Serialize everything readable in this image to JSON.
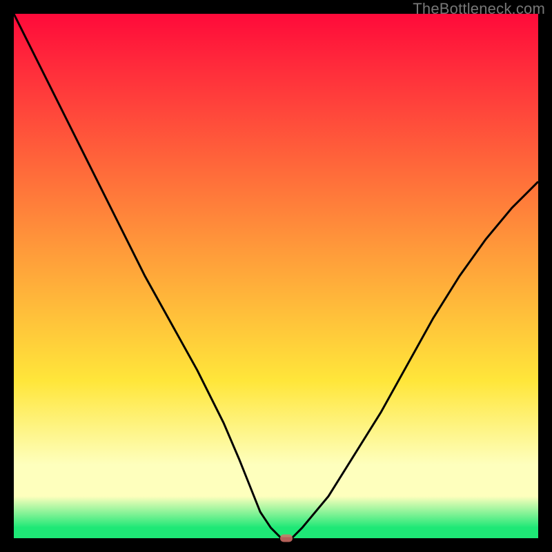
{
  "attribution": "TheBottleneck.com",
  "colors": {
    "top": "#ff0a3a",
    "red": "#ff2b3b",
    "orange": "#ff9a3a",
    "yellow": "#ffe63a",
    "pale": "#feffbd",
    "green": "#1ee876",
    "curve": "#000000",
    "marker": "#d47169",
    "frame": "#000000"
  },
  "chart_data": {
    "type": "line",
    "title": "",
    "xlabel": "",
    "ylabel": "",
    "xlim": [
      0,
      100
    ],
    "ylim": [
      0,
      100
    ],
    "x": [
      0,
      5,
      10,
      15,
      20,
      25,
      30,
      35,
      40,
      43,
      45,
      47,
      49,
      51,
      53,
      55,
      60,
      65,
      70,
      75,
      80,
      85,
      90,
      95,
      100
    ],
    "values": [
      100,
      90,
      80,
      70,
      60,
      50,
      41,
      32,
      22,
      15,
      10,
      5,
      2,
      0,
      0,
      2,
      8,
      16,
      24,
      33,
      42,
      50,
      57,
      63,
      68
    ],
    "marker": {
      "x": 52,
      "y": 0
    },
    "gradient_stops": [
      {
        "pos": 0,
        "meaning": "worst",
        "color": "#ff0a3a"
      },
      {
        "pos": 50,
        "meaning": "mid",
        "color": "#ffcf3a"
      },
      {
        "pos": 100,
        "meaning": "best",
        "color": "#1ee876"
      }
    ]
  }
}
